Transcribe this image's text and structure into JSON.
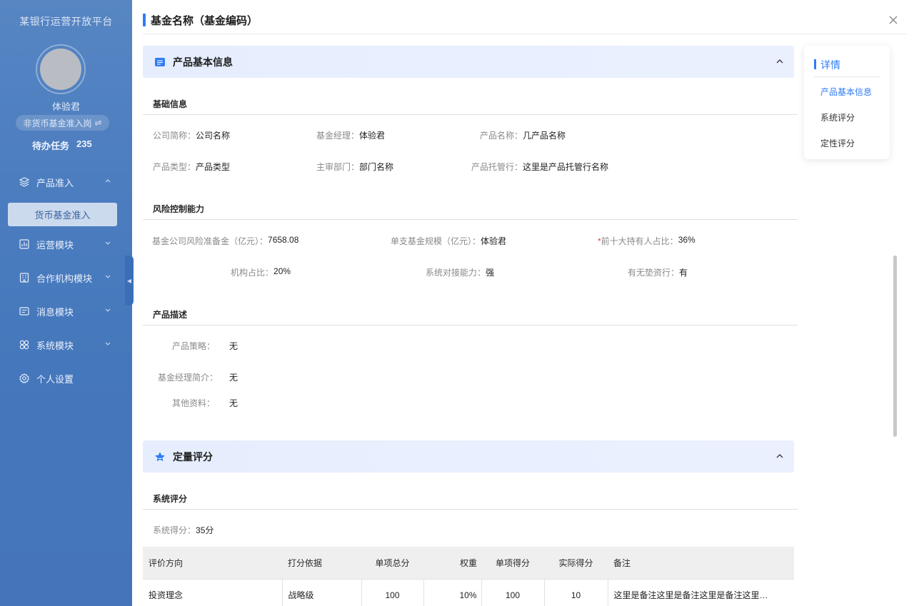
{
  "sidebar": {
    "brand": "某银行运营开放平台",
    "user_name": "体验君",
    "role": "非货币基金准入岗",
    "role_switch_glyph": "⇌",
    "todo_label": "待办任务",
    "todo_count": "235",
    "menu": [
      {
        "label": "产品准入",
        "icon": "layers-icon",
        "expanded": true
      },
      {
        "label": "运营模块",
        "icon": "chart-icon"
      },
      {
        "label": "合作机构模块",
        "icon": "building-icon"
      },
      {
        "label": "消息模块",
        "icon": "message-icon"
      },
      {
        "label": "系统模块",
        "icon": "grid-icon"
      },
      {
        "label": "个人设置",
        "icon": "gear-icon"
      }
    ],
    "active_submenu": "货币基金准入"
  },
  "panel": {
    "title": "基金名称（基金编码）"
  },
  "basic_section": {
    "title": "产品基本信息",
    "group_basic": "基础信息",
    "fields_basic": [
      {
        "label": "公司简称：",
        "value": "公司名称"
      },
      {
        "label": "基金经理：",
        "value": "体验君"
      },
      {
        "label": "产品名称：",
        "value": "几产品名称"
      },
      {
        "label": "产品类型：",
        "value": "产品类型"
      },
      {
        "label": "主审部门：",
        "value": "部门名称"
      },
      {
        "label": "产品托管行：",
        "value": "这里是产品托管行名称"
      }
    ],
    "group_risk": "风险控制能力",
    "fields_risk": [
      {
        "label": "基金公司风险准备金（亿元）：",
        "value": "7658.08"
      },
      {
        "label": "单支基金规模（亿元）：",
        "value": "体验君"
      },
      {
        "label": "前十大持有人占比：",
        "value": "36%",
        "required": "*"
      },
      {
        "label": "机构占比：",
        "value": "20%"
      },
      {
        "label": "系统对接能力：",
        "value": "强"
      },
      {
        "label": "有无垫资行：",
        "value": "有"
      }
    ],
    "group_desc": "产品描述",
    "fields_desc": [
      {
        "label": "产品策略：",
        "value": "无"
      },
      {
        "label": "基金经理简介：",
        "value": "无"
      },
      {
        "label": "其他资料：",
        "value": "无"
      }
    ]
  },
  "quant_section": {
    "title": "定量评分",
    "group_system": "系统评分",
    "score_label": "系统得分：",
    "score_value": "35分",
    "table": {
      "headers": [
        "评价方向",
        "打分依据",
        "单项总分",
        "权重",
        "单项得分",
        "实际得分",
        "备注"
      ],
      "rows": [
        [
          "投资理念",
          "战略级",
          "100",
          "10%",
          "100",
          "10",
          "这里是备注这里是备注这里是备注这里…"
        ]
      ]
    }
  },
  "anchor_nav": {
    "title": "详情",
    "items": [
      "产品基本信息",
      "系统评分",
      "定性评分"
    ],
    "active_index": 0
  },
  "colors": {
    "accent": "#2f7cf6",
    "sidebar_bg": "#3f74bb",
    "section_bg": "#e6eefd",
    "required": "#e34b3b"
  }
}
